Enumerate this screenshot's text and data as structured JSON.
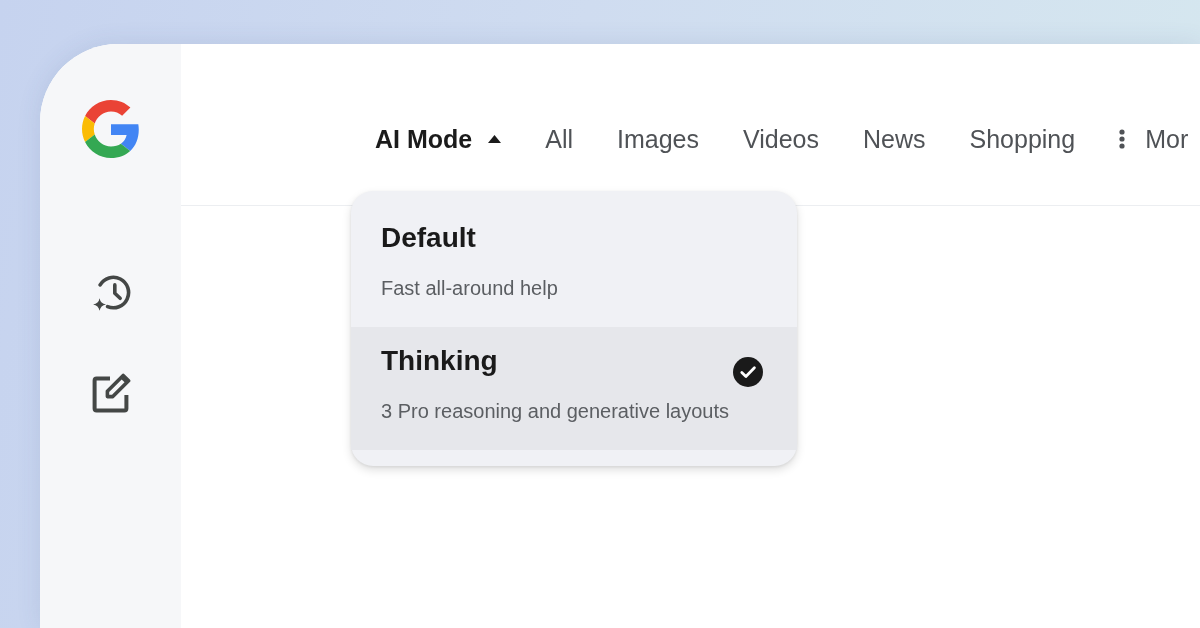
{
  "tabs": [
    {
      "kind": "dropdown",
      "label": "AI Mode",
      "selected": true,
      "expanded": true
    },
    {
      "kind": "plain",
      "label": "All",
      "selected": false
    },
    {
      "kind": "plain",
      "label": "Images",
      "selected": false
    },
    {
      "kind": "plain",
      "label": "Videos",
      "selected": false
    },
    {
      "kind": "plain",
      "label": "News",
      "selected": false
    },
    {
      "kind": "plain",
      "label": "Shopping",
      "selected": false
    },
    {
      "kind": "overflow",
      "label": "Mor",
      "selected": false
    }
  ],
  "mode_menu": {
    "options": [
      {
        "title": "Default",
        "description": "Fast all-around help",
        "selected": false
      },
      {
        "title": "Thinking",
        "description": "3 Pro reasoning and generative layouts",
        "selected": true
      }
    ]
  }
}
